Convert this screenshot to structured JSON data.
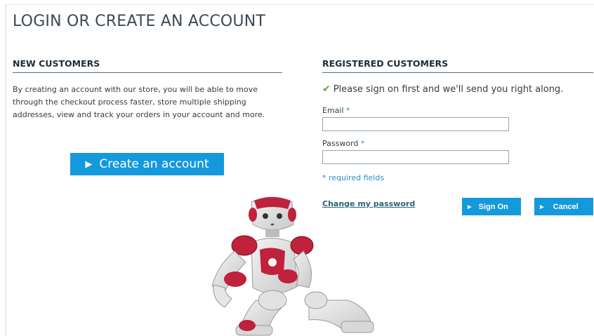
{
  "page": {
    "title": "LOGIN OR CREATE AN ACCOUNT"
  },
  "new_customers": {
    "heading": "NEW CUSTOMERS",
    "description": "By creating an account with our store, you will be able to move through the checkout process faster, store multiple shipping addresses, view and track your orders in your account and more.",
    "create_button_label": "Create an account"
  },
  "registered_customers": {
    "heading": "REGISTERED CUSTOMERS",
    "signin_message": "Please sign on first and we'll send you right along.",
    "email_label": "Email",
    "email_value": "",
    "password_label": "Password",
    "password_value": "",
    "required_star": "*",
    "required_note": "* required fields",
    "change_password_link": "Change my password",
    "signon_label": "Sign On",
    "cancel_label": "Cancel"
  },
  "colors": {
    "accent": "#1499dd",
    "heading": "#1e2c38",
    "link": "#2b6577",
    "required": "#2a8fcc",
    "check": "#5aa93a",
    "robot_accent": "#c0213d"
  },
  "icons": {
    "check": "checkmark-icon",
    "triangle": "play-triangle-icon"
  }
}
